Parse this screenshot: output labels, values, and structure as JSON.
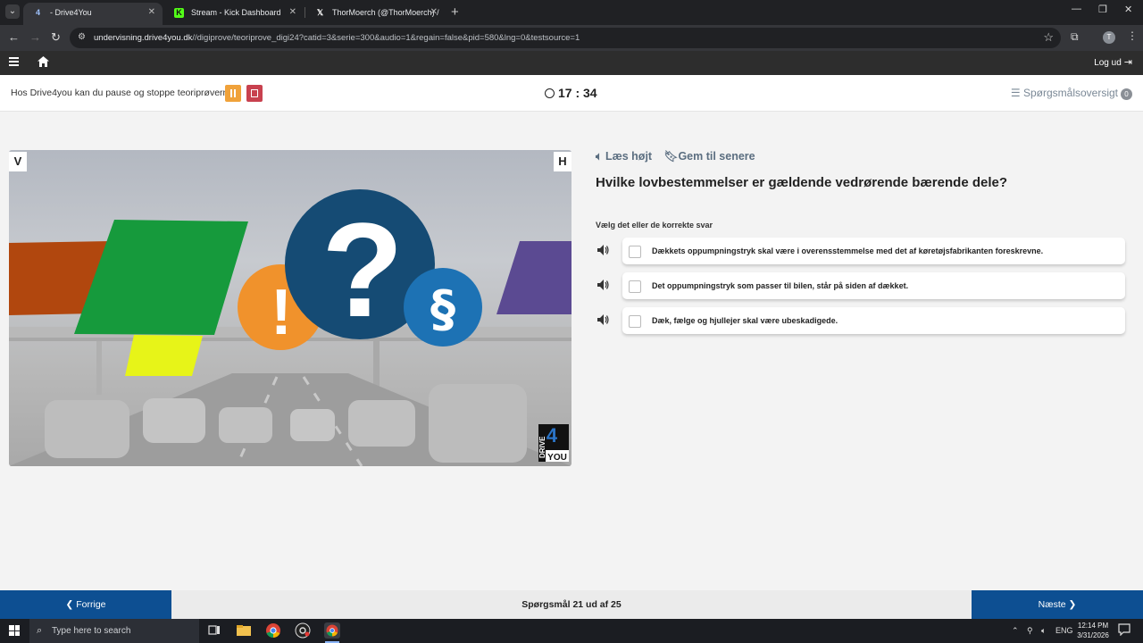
{
  "browser": {
    "tabs": [
      {
        "title": "- Drive4You",
        "favicon": "drive4you-icon",
        "active": true
      },
      {
        "title": "Stream - Kick Dashboard",
        "favicon": "kick-icon",
        "active": false
      },
      {
        "title": "ThorMoerch (@ThorMoerch) /",
        "favicon": "x-icon",
        "active": false
      }
    ],
    "url_host": "undervisning.drive4you.dk",
    "url_path": "//digiprove/teoriprove_digi24?catid=3&serie=300&audio=1&regain=false&pid=580&lng=0&testsource=1",
    "profile_initial": "T"
  },
  "site_nav": {
    "logout_label": "Log ud"
  },
  "toolbar": {
    "pause_text": "Hos Drive4you kan du pause og stoppe teoriprøverne:",
    "timer": "17 : 34",
    "overview_label": "Spørgsmålsoversigt",
    "overview_count": "0"
  },
  "image": {
    "corner_left": "V",
    "corner_right": "H",
    "watermark": "DRIVE 4 YOU",
    "colors": {
      "brown": "#b1470e",
      "green": "#169a3c",
      "yellow": "#e7f418",
      "purple": "#5b4a92",
      "orange": "#f0922c",
      "navy": "#154b74",
      "blue": "#1d72b4"
    }
  },
  "question": {
    "read_aloud": "Læs højt",
    "save_later": "Gem til senere",
    "text": "Hvilke lovbestemmelser er gældende vedrørende bærende dele?",
    "instruction": "Vælg det eller de korrekte svar",
    "answers": [
      {
        "text": "Dækkets oppumpningstryk skal være i overensstemmelse med det af køretøjsfabrikanten foreskrevne.",
        "checked": false
      },
      {
        "text": "Det oppumpningstryk som passer til bilen, står på siden af dækket.",
        "checked": false
      },
      {
        "text": "Dæk, fælge og hjullejer skal være ubeskadigede.",
        "checked": false
      }
    ]
  },
  "bottom": {
    "prev_label": "Forrige",
    "next_label": "Næste",
    "progress": "Spørgsmål 21 ud af 25"
  },
  "taskbar": {
    "search_placeholder": "Type here to search",
    "lang": "ENG",
    "time": "12:14 PM",
    "date": "3/31/2026"
  }
}
